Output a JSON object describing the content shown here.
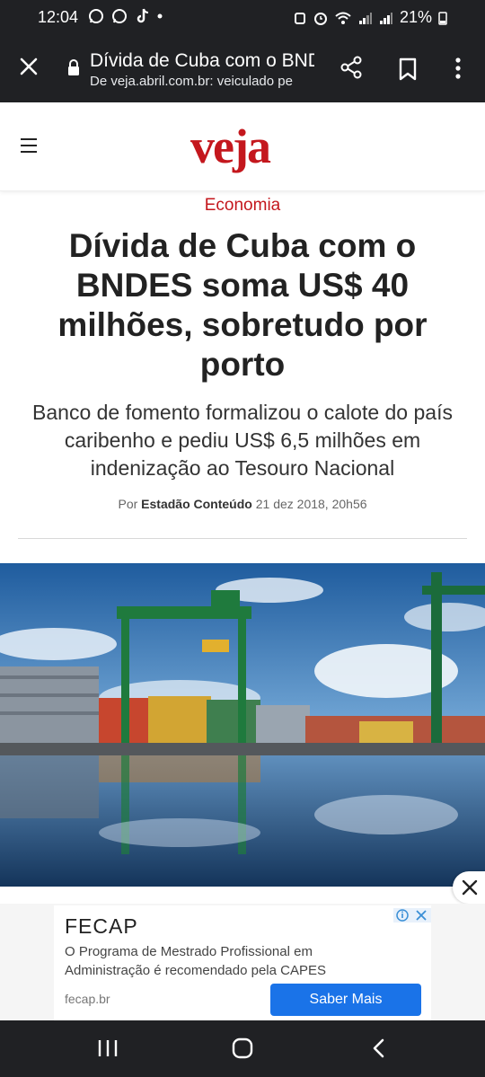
{
  "status": {
    "time": "12:04",
    "battery": "21%"
  },
  "browser": {
    "page_title": "Dívida de Cuba com o BNDES soma US$ 40 milhões, sobretudo por porto",
    "url_line": "De veja.abril.com.br: veiculado pe"
  },
  "site": {
    "logo": "veja"
  },
  "article": {
    "section": "Economia",
    "headline": "Dívida de Cuba com o BNDES soma US$ 40 milhões, sobretudo por porto",
    "subheadline": "Banco de fomento formalizou o calote do país caribenho e pediu US$ 6,5 milhões em indenização ao Tesouro Nacional",
    "byline_prefix": "Por",
    "author": "Estadão Conteúdo",
    "date": "21 dez 2018, 20h56"
  },
  "ad": {
    "brand": "FECAP",
    "text": "O Programa de Mestrado Profissional em Administração é recomendado pela CAPES",
    "url": "fecap.br",
    "cta": "Saber Mais"
  },
  "colors": {
    "brand_red": "#c4171d",
    "chrome_dark": "#202124",
    "ad_button": "#1a73e8"
  }
}
